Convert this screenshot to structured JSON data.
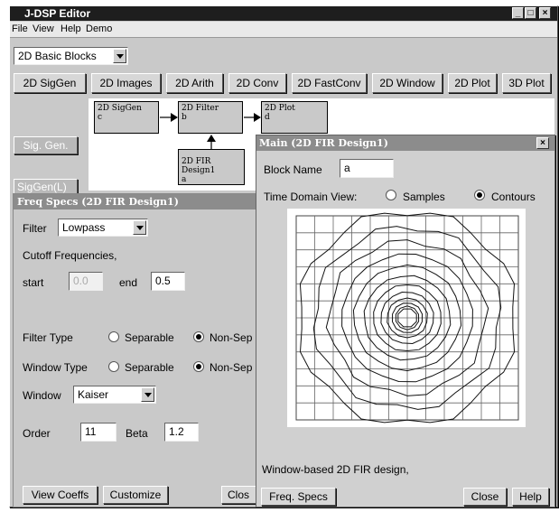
{
  "app": {
    "title": "J-DSP Editor",
    "menu": [
      "File",
      "View",
      "Help",
      "Demo"
    ],
    "window_controls": [
      "_",
      "□",
      "×"
    ],
    "category_select": "2D Basic Blocks",
    "toolbar": [
      "2D SigGen",
      "2D Images",
      "2D Arith",
      "2D Conv",
      "2D FastConv",
      "2D Window",
      "2D Plot",
      "3D Plot"
    ],
    "side_buttons": {
      "sig_gen": "Sig. Gen.",
      "sig_gen_l": "SigGen(L)"
    }
  },
  "canvas": {
    "blocks": [
      {
        "name": "2D SigGen",
        "id": "c"
      },
      {
        "name": "2D Filter",
        "id": "b"
      },
      {
        "name": "2D Plot",
        "id": "d"
      },
      {
        "name": "2D FIR Design1",
        "id": "a"
      }
    ]
  },
  "freq_specs": {
    "title": "Freq Specs (2D FIR Design1)",
    "filter_label": "Filter",
    "filter_value": "Lowpass",
    "cutoff_label": "Cutoff Frequencies,",
    "start_label": "start",
    "start_value": "0.0",
    "end_label": "end",
    "end_value": "0.5",
    "filter_type_label": "Filter Type",
    "filter_type_options": [
      "Separable",
      "Non-Sep"
    ],
    "filter_type_selected": "Non-Sep",
    "window_type_label": "Window Type",
    "window_type_options": [
      "Separable",
      "Non-Sep"
    ],
    "window_type_selected": "Non-Sep",
    "window_label": "Window",
    "window_value": "Kaiser",
    "order_label": "Order",
    "order_value": "11",
    "beta_label": "Beta",
    "beta_value": "1.2",
    "buttons": {
      "view_coeffs": "View Coeffs",
      "customize": "Customize",
      "close": "Clos"
    }
  },
  "main_dialog": {
    "title": "Main (2D FIR Design1)",
    "close_glyph": "×",
    "block_name_label": "Block Name",
    "block_name_value": "a",
    "time_domain_label": "Time Domain View:",
    "view_options": [
      "Samples",
      "Contours"
    ],
    "view_selected": "Contours",
    "plot": {
      "type": "contour",
      "grid_cells": 12,
      "contour_levels": 12
    },
    "description": "Window-based 2D FIR design,",
    "buttons": {
      "freq_specs": "Freq. Specs",
      "close": "Close",
      "help": "Help"
    }
  },
  "colors": {
    "titlebar_active": "#1e1e1e",
    "titlebar_inactive": "#8c8c8c",
    "panel": "#c9c9c9",
    "canvas": "#ffffff"
  }
}
